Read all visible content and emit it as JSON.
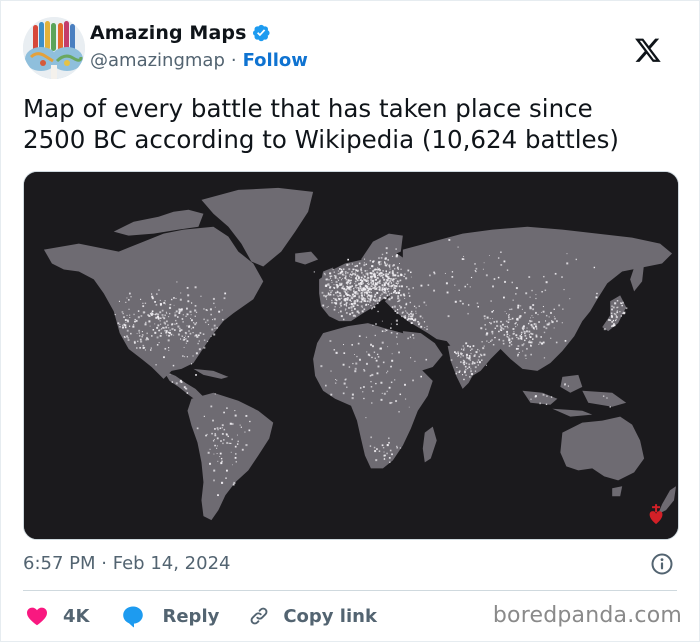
{
  "author": {
    "display_name": "Amazing Maps",
    "verified": true,
    "handle": "@amazingmap",
    "separator": "·",
    "follow_label": "Follow",
    "avatar_icon": "hands-painted-world-avatar"
  },
  "platform": {
    "logo_icon": "x-logo-icon"
  },
  "tweet": {
    "text_line1": "Map of every battle that has taken place since",
    "text_line2": "2500 BC according to Wikipedia (10,624 battles)",
    "media": {
      "description": "World map on dark background with white dots marking battle locations",
      "battle_count": "10,624",
      "colors": {
        "ocean": "#1b1a1d",
        "land": "#6e6b72",
        "battle_dot": "#f2f0f4",
        "logo_mark": "#d32027"
      },
      "corner_mark_icon": "red-heart-cross-logo-icon"
    },
    "time": "6:57 PM",
    "date": "Feb 14, 2024",
    "meta_separator": "·",
    "info_icon": "info-circle-icon"
  },
  "actions": {
    "likes": {
      "icon": "heart-icon",
      "count": "4K",
      "color": "#f91880"
    },
    "reply": {
      "icon": "speech-bubble-icon",
      "label": "Reply",
      "color": "#1d9bf0"
    },
    "copy_link": {
      "icon": "link-icon",
      "label": "Copy link"
    }
  },
  "watermark": "boredpanda.com"
}
